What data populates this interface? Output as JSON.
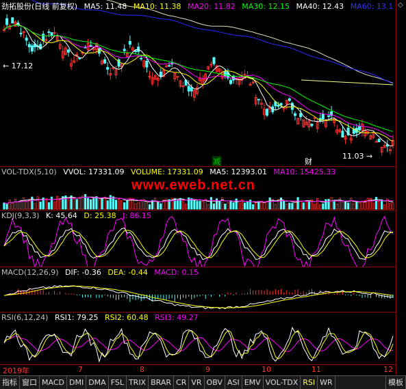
{
  "main": {
    "title": "劲拓股份(日线 前复权)",
    "indicators": [
      {
        "label": "MA5: 11.48",
        "color": "#ffffff"
      },
      {
        "label": "MA10: 11.38",
        "color": "#ffff00"
      },
      {
        "label": "MA20: 11.82",
        "color": "#ff00ff"
      },
      {
        "label": "MA30: 12.15",
        "color": "#00ff00"
      },
      {
        "label": "MA40: 12.43",
        "color": "#ffffff"
      },
      {
        "label": "MA60: 13.1",
        "color": "#0000ff"
      }
    ],
    "high_label": "17.12",
    "low_label": "11.03",
    "markers": [
      {
        "text": "减",
        "color": "#00cc00"
      },
      {
        "text": "财",
        "color": "#ffffff"
      }
    ]
  },
  "vol": {
    "indicators": [
      {
        "label": "VOL-TDX(5,10)",
        "color": "#c0c0c0"
      },
      {
        "label": "VVOL: 17331.09",
        "color": "#ffffff"
      },
      {
        "label": "VOLUME: 17331.09",
        "color": "#ffff00"
      },
      {
        "label": "MA5: 12393.01",
        "color": "#ffffff"
      },
      {
        "label": "MA10: 15425.33",
        "color": "#ff00ff"
      }
    ]
  },
  "watermark": "www.eweb.net.cn",
  "kdj": {
    "indicators": [
      {
        "label": "KDJ(9,3,3)",
        "color": "#c0c0c0"
      },
      {
        "label": "K: 45.64",
        "color": "#ffffff"
      },
      {
        "label": "D: 25.38",
        "color": "#ffff00"
      },
      {
        "label": "J: 86.15",
        "color": "#ff00ff"
      }
    ]
  },
  "macd": {
    "indicators": [
      {
        "label": "MACD(12,26,9)",
        "color": "#c0c0c0"
      },
      {
        "label": "DIF: -0.36",
        "color": "#ffffff"
      },
      {
        "label": "DEA: -0.44",
        "color": "#ffff00"
      },
      {
        "label": "MACD: 0.15",
        "color": "#ff00ff"
      }
    ]
  },
  "rsi": {
    "indicators": [
      {
        "label": "RSI(6,12,24)",
        "color": "#c0c0c0"
      },
      {
        "label": "RSI1: 79.25",
        "color": "#ffffff"
      },
      {
        "label": "RSI2: 60.48",
        "color": "#ffff00"
      },
      {
        "label": "RSI3: 49.27",
        "color": "#ff00ff"
      }
    ]
  },
  "time_axis": [
    "2019年",
    "7",
    "8",
    "9",
    "10",
    "11",
    "12"
  ],
  "tabs": [
    "指标",
    "窗口",
    "MACD",
    "DMI",
    "DMA",
    "FSL",
    "TRIX",
    "BRAR",
    "CR",
    "VR",
    "OBV",
    "ASI",
    "EMV",
    "VOL-TDX",
    "RSI",
    "WR",
    "模板"
  ],
  "active_tab": "RSI",
  "right_icon": "diamond-icon"
}
